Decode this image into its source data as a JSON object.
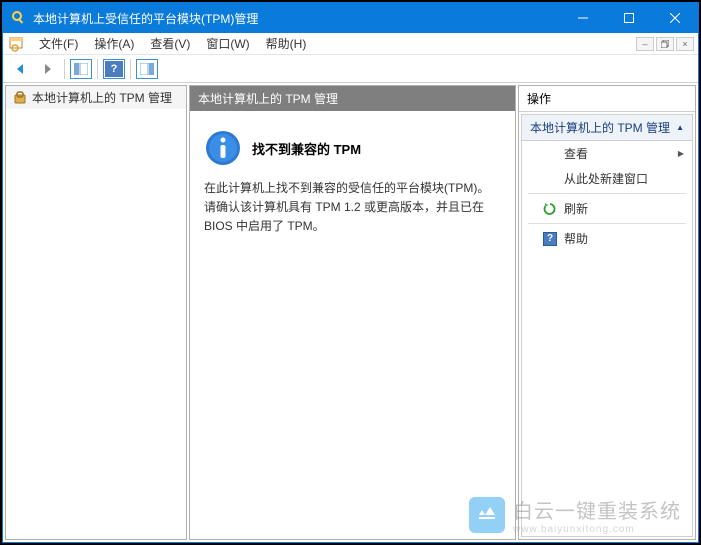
{
  "titlebar": {
    "title": "本地计算机上受信任的平台模块(TPM)管理"
  },
  "menubar": {
    "file": "文件(F)",
    "action": "操作(A)",
    "view": "查看(V)",
    "window": "窗口(W)",
    "help": "帮助(H)"
  },
  "tree": {
    "root": "本地计算机上的 TPM 管理"
  },
  "content": {
    "header": "本地计算机上的 TPM 管理",
    "info_title": "找不到兼容的 TPM",
    "info_text": "在此计算机上找不到兼容的受信任的平台模块(TPM)。请确认该计算机具有 TPM 1.2 或更高版本，并且已在 BIOS 中启用了 TPM。"
  },
  "actions": {
    "header": "操作",
    "group": "本地计算机上的 TPM 管理",
    "view": "查看",
    "new_window": "从此处新建窗口",
    "refresh": "刷新",
    "help": "帮助"
  },
  "watermark": {
    "brand": "白云一键重装系统",
    "url": "www.baiyunxitong.com"
  }
}
